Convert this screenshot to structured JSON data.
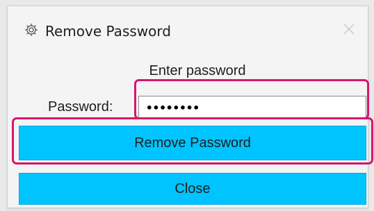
{
  "dialog": {
    "title": "Remove Password",
    "app_icon": "gear-app-icon",
    "close_icon": "close-icon"
  },
  "form": {
    "prompt": "Enter password",
    "password_label": "Password:",
    "password_value": "••••••••"
  },
  "buttons": {
    "remove_label": "Remove Password",
    "close_label": "Close"
  },
  "colors": {
    "button_bg": "#00c4ff",
    "highlight": "#d6166f",
    "input_focus": "#0067c0"
  }
}
